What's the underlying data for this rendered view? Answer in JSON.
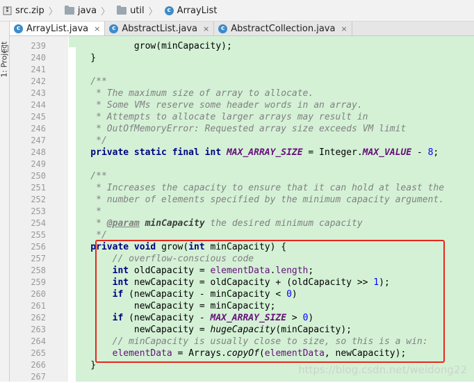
{
  "breadcrumbs": [
    {
      "label": "src.zip",
      "icon": "zip-archive-icon"
    },
    {
      "label": "java",
      "icon": "folder-icon"
    },
    {
      "label": "util",
      "icon": "folder-icon"
    },
    {
      "label": "ArrayList",
      "icon": "class-icon"
    }
  ],
  "tool_window": {
    "label": "1: Project"
  },
  "tabs": [
    {
      "label": "ArrayList.java",
      "close": "×",
      "active": true
    },
    {
      "label": "AbstractList.java",
      "close": "×",
      "active": false
    },
    {
      "label": "AbstractCollection.java",
      "close": "×",
      "active": false
    }
  ],
  "colors": {
    "highlight_band": "#d4f1d6",
    "selection_border": "#e8261c",
    "keyword": "#000080",
    "comment": "#808080"
  },
  "line_numbers": [
    "239",
    "240",
    "241",
    "242",
    "243",
    "244",
    "245",
    "246",
    "247",
    "248",
    "249",
    "250",
    "251",
    "252",
    "253",
    "254",
    "255",
    "256",
    "257",
    "258",
    "259",
    "260",
    "261",
    "262",
    "263",
    "264",
    "265",
    "266",
    "267"
  ],
  "code": {
    "l239": {
      "indent": "            ",
      "a": "grow(",
      "b": "minCapacity",
      "c": ");"
    },
    "l240": "    }",
    "l242": "    /**",
    "l243": "     * The maximum size of array to allocate.",
    "l244": "     * Some VMs reserve some header words in an array.",
    "l245": "     * Attempts to allocate larger arrays may result in",
    "l246": "     * OutOfMemoryError: Requested array size exceeds VM limit",
    "l247": "     */",
    "l248": {
      "kw": "    private static final int ",
      "const": "MAX_ARRAY_SIZE",
      "mid": " = Integer.",
      "const2": "MAX_VALUE",
      "op": " - ",
      "num": "8",
      "end": ";"
    },
    "l250": "    /**",
    "l251": "     * Increases the capacity to ensure that it can hold at least the",
    "l252": "     * number of elements specified by the minimum capacity argument.",
    "l253": "     *",
    "l254": {
      "pre": "     * ",
      "tag": "@param",
      "sp": " ",
      "param": "minCapacity",
      "desc": " the desired minimum capacity"
    },
    "l255": "     */",
    "l256": {
      "kw": "    private void ",
      "rest": "grow(",
      "kw2": "int ",
      "rest2": "minCapacity) {"
    },
    "l257": "        // overflow-conscious code",
    "l258": {
      "kw": "        int ",
      "a": "oldCapacity = ",
      "fld": "elementData",
      "b": ".",
      "fld2": "length",
      "c": ";"
    },
    "l259": {
      "kw": "        int ",
      "a": "newCapacity = oldCapacity + (oldCapacity >> ",
      "num": "1",
      "c": ");"
    },
    "l260": {
      "kw": "        if ",
      "a": "(newCapacity - minCapacity < ",
      "num": "0",
      "c": ")"
    },
    "l261": "            newCapacity = minCapacity;",
    "l262": {
      "kw": "        if ",
      "a": "(newCapacity - ",
      "const": "MAX_ARRAY_SIZE",
      "b": " > ",
      "num": "0",
      "c": ")"
    },
    "l263": {
      "a": "            newCapacity = ",
      "mth": "hugeCapacity",
      "c": "(minCapacity);"
    },
    "l264": "        // minCapacity is usually close to size, so this is a win:",
    "l265": {
      "fld": "        elementData",
      "a": " = Arrays.",
      "mth": "copyOf",
      "b": "(",
      "fld2": "elementData",
      "c": ", newCapacity);"
    },
    "l266": "    }"
  },
  "watermark": "https://blog.csdn.net/weidong22"
}
